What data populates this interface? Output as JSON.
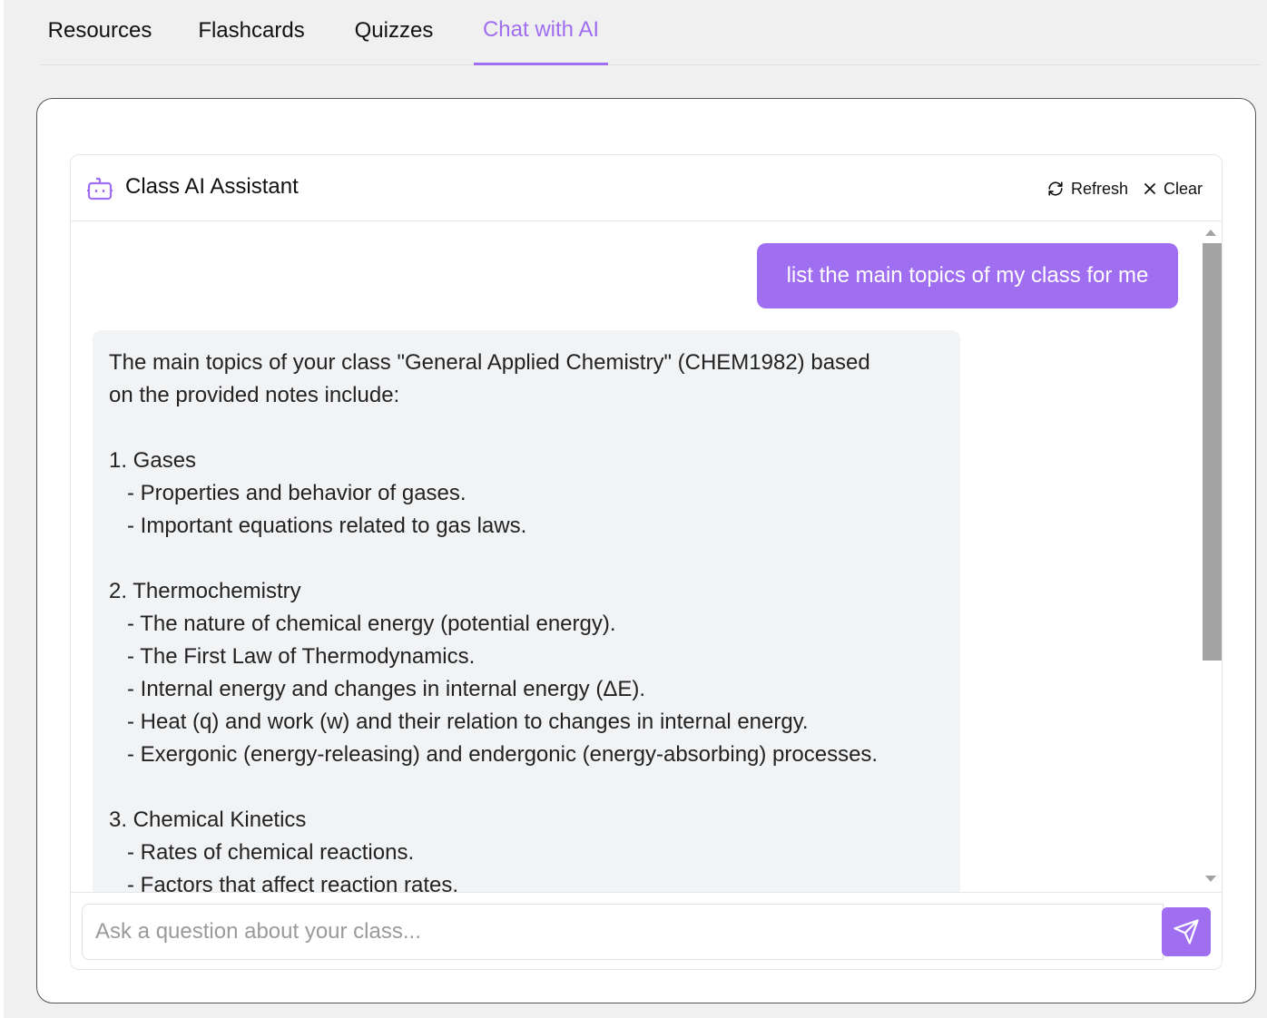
{
  "tabs": [
    {
      "label": "Resources"
    },
    {
      "label": "Flashcards"
    },
    {
      "label": "Quizzes"
    },
    {
      "label": "Chat with AI",
      "active": true
    }
  ],
  "chat": {
    "title": "Class AI Assistant",
    "refresh_label": "Refresh",
    "clear_label": "Clear",
    "icons": {
      "assistant": "robot-icon",
      "refresh": "refresh-icon",
      "clear": "close-icon",
      "send": "send-icon"
    },
    "accent_color": "#a06ef0",
    "messages": [
      {
        "role": "user",
        "text": "list the main topics of my class for me"
      },
      {
        "role": "assistant",
        "text": "The main topics of your class \"General Applied Chemistry\" (CHEM1982) based\non the provided notes include:\n\n1. Gases\n   - Properties and behavior of gases.\n   - Important equations related to gas laws.\n\n2. Thermochemistry\n   - The nature of chemical energy (potential energy).\n   - The First Law of Thermodynamics.\n   - Internal energy and changes in internal energy (ΔE).\n   - Heat (q) and work (w) and their relation to changes in internal energy.\n   - Exergonic (energy-releasing) and endergonic (energy-absorbing) processes.\n\n3. Chemical Kinetics\n   - Rates of chemical reactions.\n   - Factors that affect reaction rates."
      }
    ],
    "input_placeholder": "Ask a question about your class...",
    "input_value": ""
  }
}
